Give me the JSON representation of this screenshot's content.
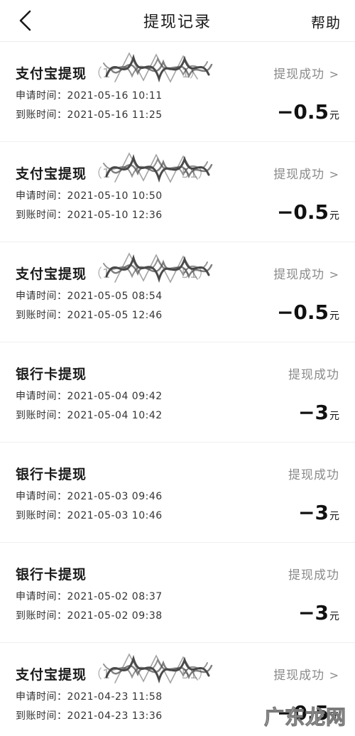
{
  "header": {
    "title": "提现记录",
    "help_label": "帮助"
  },
  "labels": {
    "apply_prefix": "申请时间：",
    "arrive_prefix": "到账时间：",
    "currency_unit": "元"
  },
  "records": [
    {
      "title": "支付宝提现",
      "account": "（1",
      "account_tail": "1）",
      "status": "提现成功",
      "apply_time": "2021-05-16  10:11",
      "arrive_time": "2021-05-16  11:25",
      "amount": "−0.5",
      "scribbled": true
    },
    {
      "title": "支付宝提现",
      "account": "（1",
      "account_tail": "51）",
      "status": "提现成功",
      "apply_time": "2021-05-10  10:50",
      "arrive_time": "2021-05-10  12:36",
      "amount": "−0.5",
      "scribbled": true
    },
    {
      "title": "支付宝提现",
      "account": "（1",
      "account_tail": "51）",
      "status": "提现成功",
      "apply_time": "2021-05-05  08:54",
      "arrive_time": "2021-05-05  12:46",
      "amount": "−0.5",
      "scribbled": true
    },
    {
      "title": "银行卡提现",
      "account": "",
      "account_tail": "",
      "status": "提现成功",
      "apply_time": "2021-05-04  09:42",
      "arrive_time": "2021-05-04  10:42",
      "amount": "−3",
      "scribbled": false
    },
    {
      "title": "银行卡提现",
      "account": "",
      "account_tail": "",
      "status": "提现成功",
      "apply_time": "2021-05-03  09:46",
      "arrive_time": "2021-05-03  10:46",
      "amount": "−3",
      "scribbled": false
    },
    {
      "title": "银行卡提现",
      "account": "",
      "account_tail": "",
      "status": "提现成功",
      "apply_time": "2021-05-02  08:37",
      "arrive_time": "2021-05-02  09:38",
      "amount": "−3",
      "scribbled": false
    },
    {
      "title": "支付宝提现",
      "account": "（1",
      "account_tail": "51）",
      "status": "提现成功",
      "apply_time": "2021-04-23  11:58",
      "arrive_time": "2021-04-23  13:36",
      "amount": "−0.5",
      "scribbled": true
    }
  ],
  "watermark": "广东龙网",
  "colors": {
    "status": "#8a8a8a",
    "text": "#1a1a1a",
    "divider": "#efefef"
  }
}
